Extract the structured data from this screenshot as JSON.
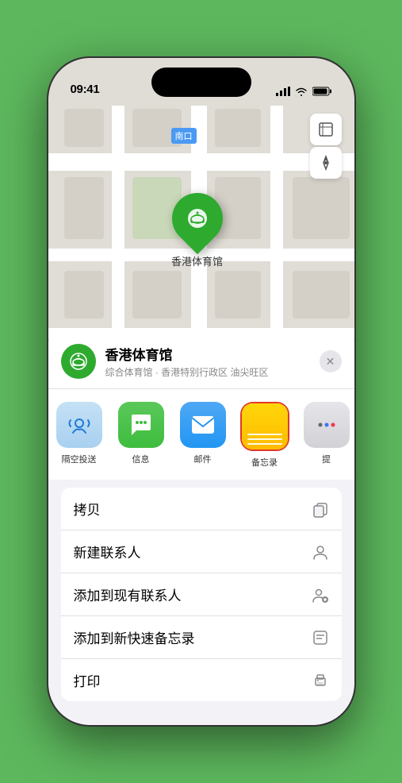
{
  "status_bar": {
    "time": "09:41",
    "signal_label": "signal",
    "wifi_label": "wifi",
    "battery_label": "battery"
  },
  "map": {
    "location_label": "南口",
    "pin_name": "香港体育馆",
    "pin_emoji": "🏟"
  },
  "map_controls": {
    "layers_icon": "🗺",
    "location_icon": "↗"
  },
  "sheet": {
    "title": "香港体育馆",
    "subtitle": "综合体育馆 · 香港特别行政区 油尖旺区",
    "close_label": "✕"
  },
  "share_items": [
    {
      "id": "airdrop",
      "label": "隔空投送",
      "icon": "airdrop"
    },
    {
      "id": "messages",
      "label": "信息",
      "icon": "messages"
    },
    {
      "id": "mail",
      "label": "邮件",
      "icon": "mail"
    },
    {
      "id": "notes",
      "label": "备忘录",
      "icon": "notes"
    },
    {
      "id": "more",
      "label": "提",
      "icon": "more"
    }
  ],
  "actions": [
    {
      "id": "copy",
      "label": "拷贝",
      "icon": "copy"
    },
    {
      "id": "new-contact",
      "label": "新建联系人",
      "icon": "new-contact"
    },
    {
      "id": "add-contact",
      "label": "添加到现有联系人",
      "icon": "add-contact"
    },
    {
      "id": "quick-note",
      "label": "添加到新快速备忘录",
      "icon": "quick-note"
    },
    {
      "id": "print",
      "label": "打印",
      "icon": "print"
    }
  ],
  "colors": {
    "green_accent": "#2eaa2e",
    "red_border": "#e0392a",
    "notes_yellow": "#ffd60a"
  }
}
